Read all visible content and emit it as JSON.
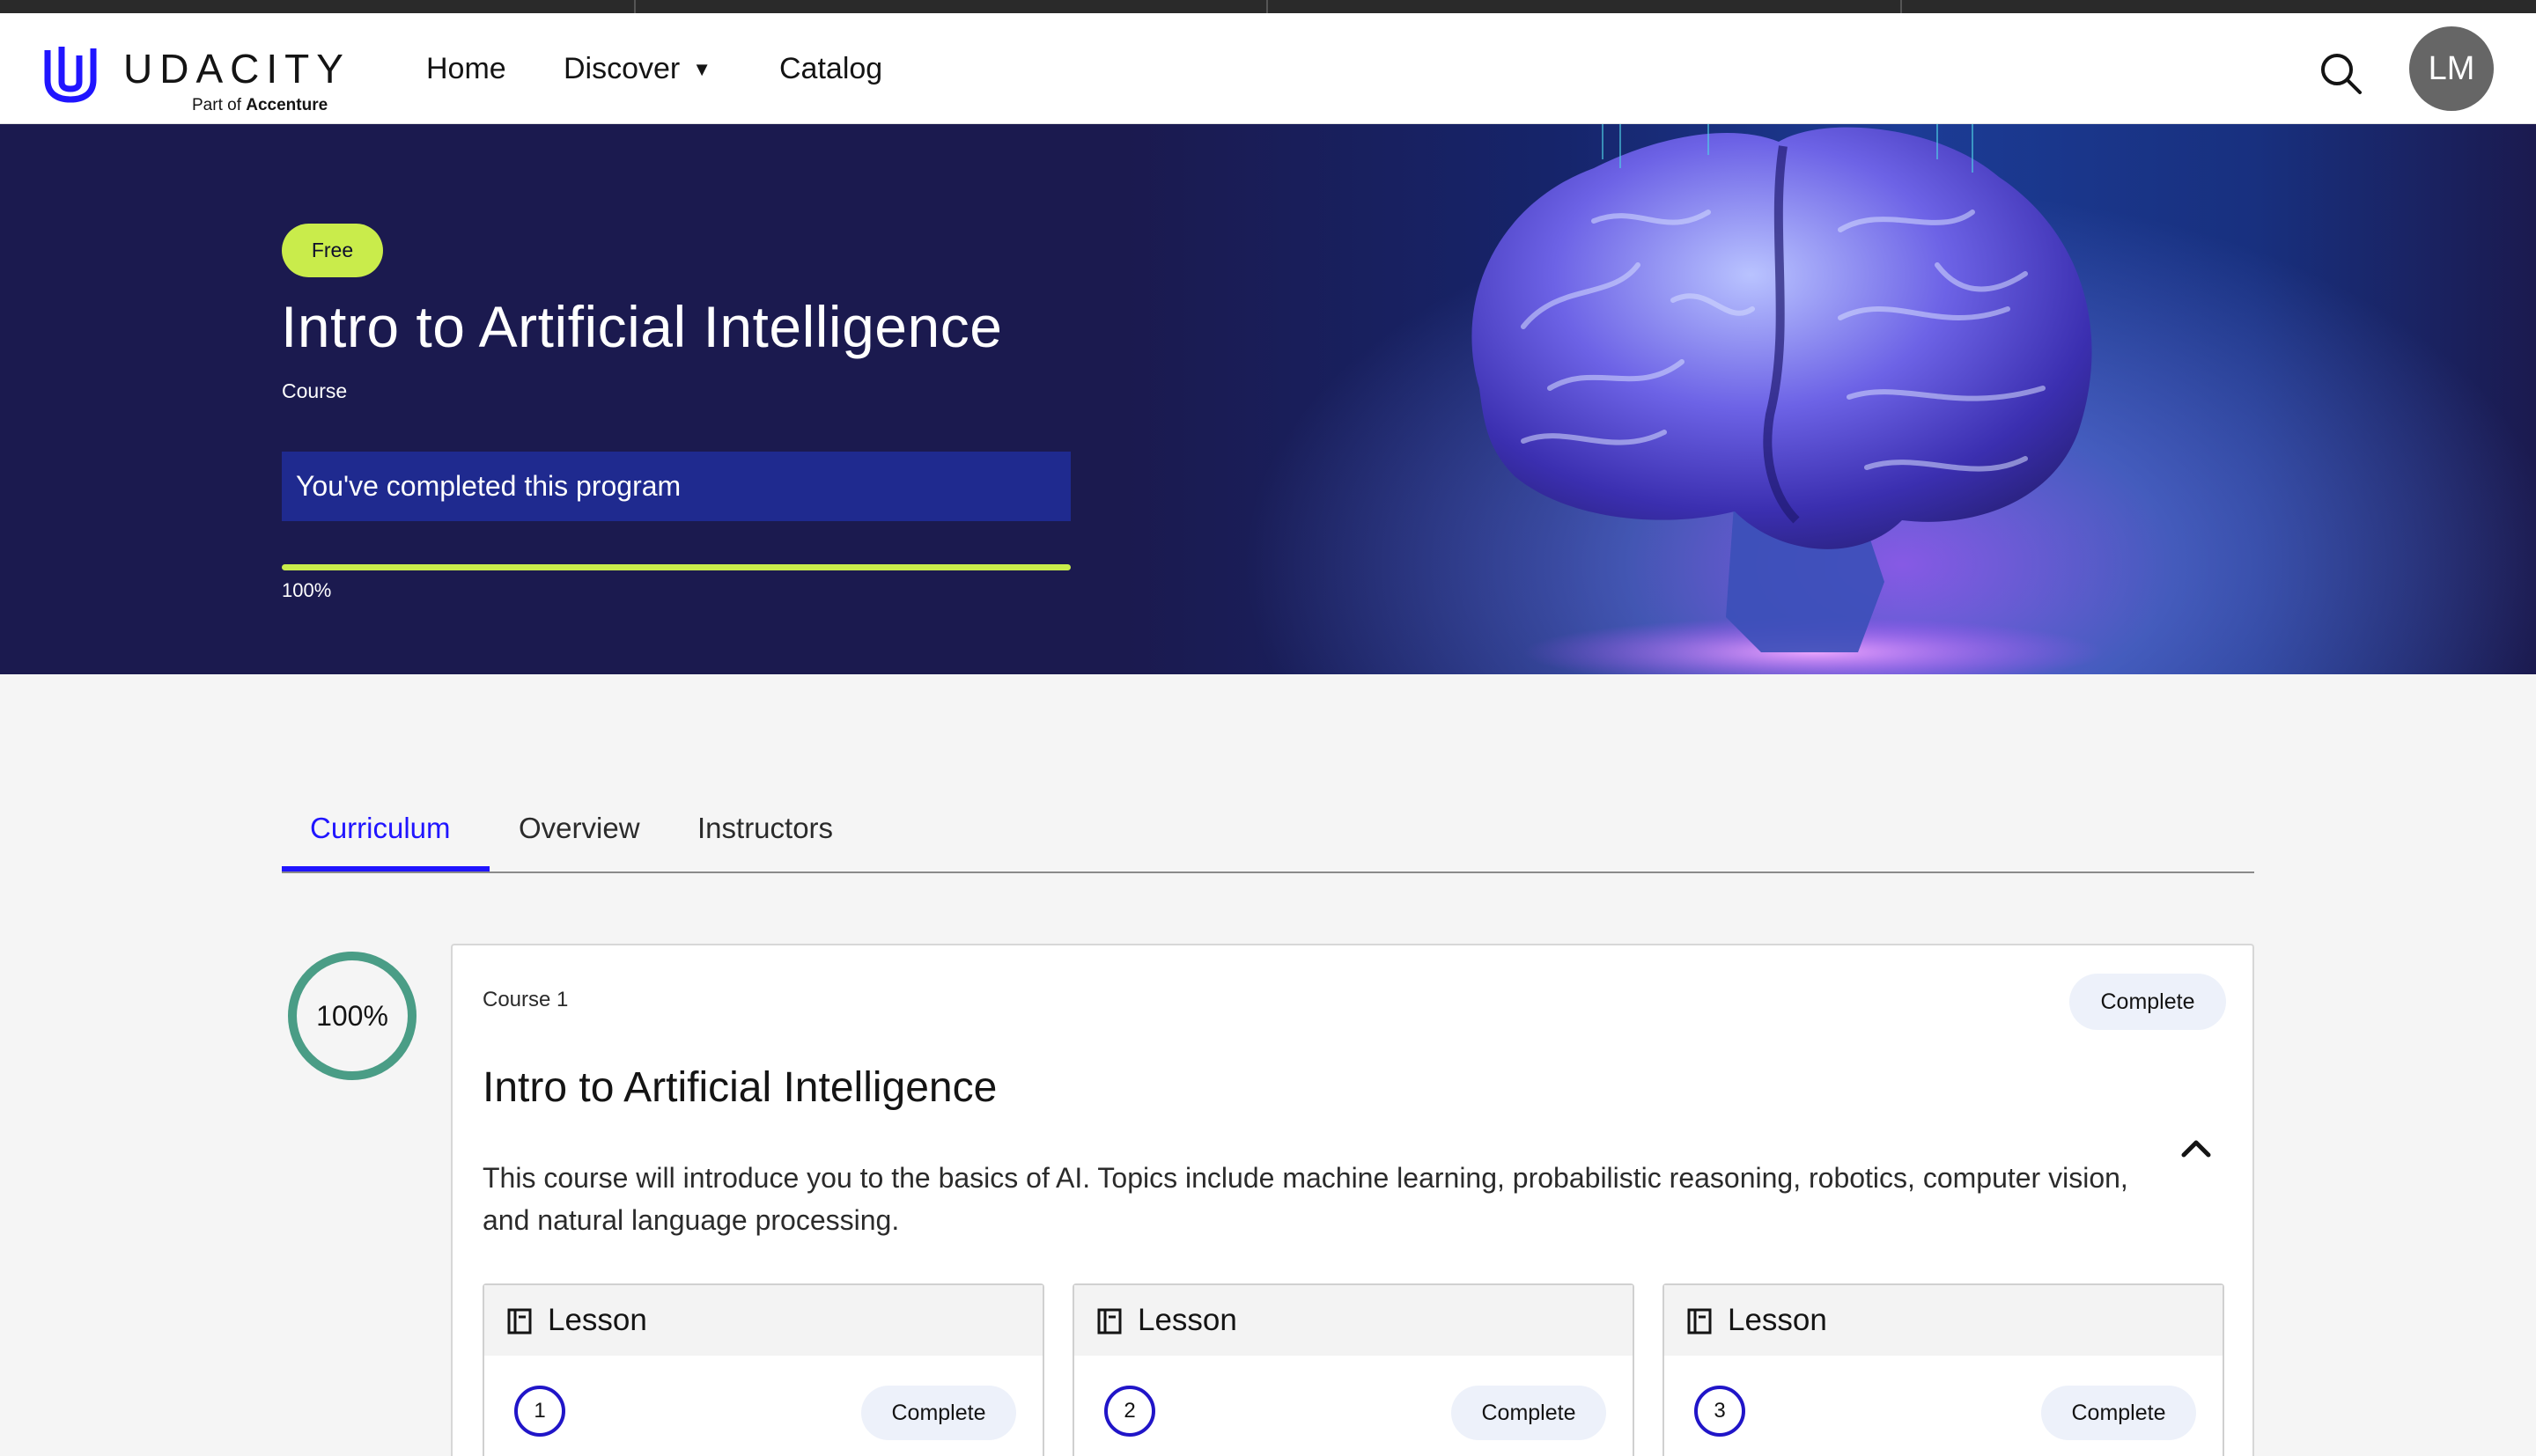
{
  "header": {
    "logo_word": "UDACITY",
    "logo_sub_prefix": "Part of ",
    "logo_sub_brand": "Accenture",
    "nav": [
      {
        "label": "Home"
      },
      {
        "label": "Discover"
      },
      {
        "label": "Catalog"
      }
    ],
    "avatar_initials": "LM",
    "icons": [
      "udacity-logo-icon",
      "chevron-down-icon",
      "search-icon"
    ]
  },
  "hero": {
    "badge": "Free",
    "title": "Intro to Artificial Intelligence",
    "type": "Course",
    "completed_message": "You've completed this program",
    "progress_percent": 100,
    "progress_label": "100%"
  },
  "tabs": [
    {
      "label": "Curriculum",
      "active": true
    },
    {
      "label": "Overview",
      "active": false
    },
    {
      "label": "Instructors",
      "active": false
    }
  ],
  "course_card": {
    "progress_label": "100%",
    "progress_fraction": 1.0,
    "kicker": "Course 1",
    "status": "Complete",
    "title": "Intro to Artificial Intelligence",
    "description": "This course will introduce you to the basics of AI. Topics include machine learning, probabilistic reasoning, robotics, computer vision, and natural language processing.",
    "lessons": [
      {
        "label": "Lesson",
        "number": "1",
        "status": "Complete"
      },
      {
        "label": "Lesson",
        "number": "2",
        "status": "Complete"
      },
      {
        "label": "Lesson",
        "number": "3",
        "status": "Complete"
      }
    ]
  },
  "colors": {
    "hero_bg": "#1b1a4f",
    "accent_lime": "#c9ec4b",
    "active_tab": "#2015ff",
    "ring_green": "#4a9d86",
    "lesson_ring": "#2015c8"
  }
}
